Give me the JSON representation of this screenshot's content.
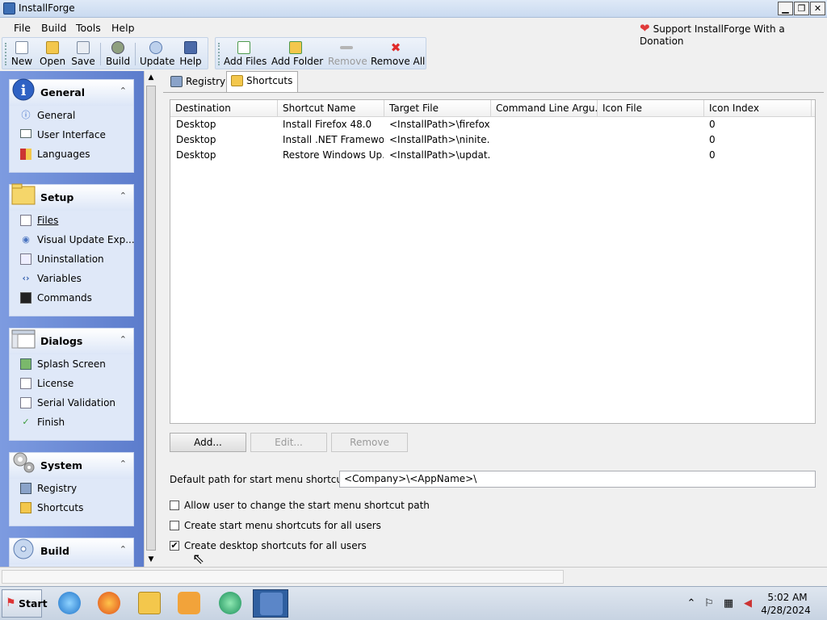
{
  "window": {
    "title": "InstallForge",
    "min": "▁",
    "max": "❐",
    "close": "✕"
  },
  "menu": {
    "items": [
      "File",
      "Build",
      "Tools",
      "Help"
    ],
    "donate": "Support InstallForge With a Donation"
  },
  "toolbar": {
    "new": "New",
    "open": "Open",
    "save": "Save",
    "build": "Build",
    "update": "Update",
    "help": "Help",
    "add_files": "Add Files",
    "add_folder": "Add Folder",
    "remove": "Remove",
    "remove_all": "Remove All"
  },
  "sidebar": {
    "general": {
      "title": "General",
      "items": [
        "General",
        "User Interface",
        "Languages"
      ]
    },
    "setup": {
      "title": "Setup",
      "items": [
        "Files",
        "Visual Update Exp...",
        "Uninstallation",
        "Variables",
        "Commands"
      ]
    },
    "dialogs": {
      "title": "Dialogs",
      "items": [
        "Splash Screen",
        "License",
        "Serial Validation",
        "Finish"
      ]
    },
    "system": {
      "title": "System",
      "items": [
        "Registry",
        "Shortcuts"
      ]
    },
    "build": {
      "title": "Build"
    }
  },
  "tabs": [
    "Registry",
    "Shortcuts"
  ],
  "grid": {
    "columns": [
      "Destination",
      "Shortcut Name",
      "Target File",
      "Command Line Argu...",
      "Icon File",
      "Icon Index"
    ],
    "rows": [
      [
        "Desktop",
        "Install Firefox 48.0",
        "<InstallPath>\\firefox...",
        "",
        "",
        "0"
      ],
      [
        "Desktop",
        "Install .NET Framewo...",
        "<InstallPath>\\ninite....",
        "",
        "",
        "0"
      ],
      [
        "Desktop",
        "Restore Windows Up...",
        "<InstallPath>\\updat...",
        "",
        "",
        "0"
      ]
    ]
  },
  "buttons": {
    "add": "Add...",
    "edit": "Edit...",
    "remove": "Remove"
  },
  "start_menu_path": {
    "label": "Default path for start menu shortcuts:",
    "value": "<Company>\\<AppName>\\"
  },
  "checkboxes": [
    {
      "label": "Allow user to change the start menu shortcut path",
      "checked": false,
      "mark": ""
    },
    {
      "label": "Create start menu shortcuts for all users",
      "checked": false,
      "mark": ""
    },
    {
      "label": "Create desktop shortcuts for all users",
      "checked": true,
      "mark": "✔"
    }
  ],
  "taskbar": {
    "start": "Start",
    "time": "5:02 AM",
    "date": "4/28/2024"
  },
  "colors": {
    "sidebar": "#6d8bd6",
    "accent_heart": "#e03a3a",
    "taskbar_active": "#2f5fa0"
  },
  "icons": {
    "tray": [
      "chevron-up-icon",
      "flag-icon",
      "network-icon",
      "volume-muted-icon"
    ]
  }
}
